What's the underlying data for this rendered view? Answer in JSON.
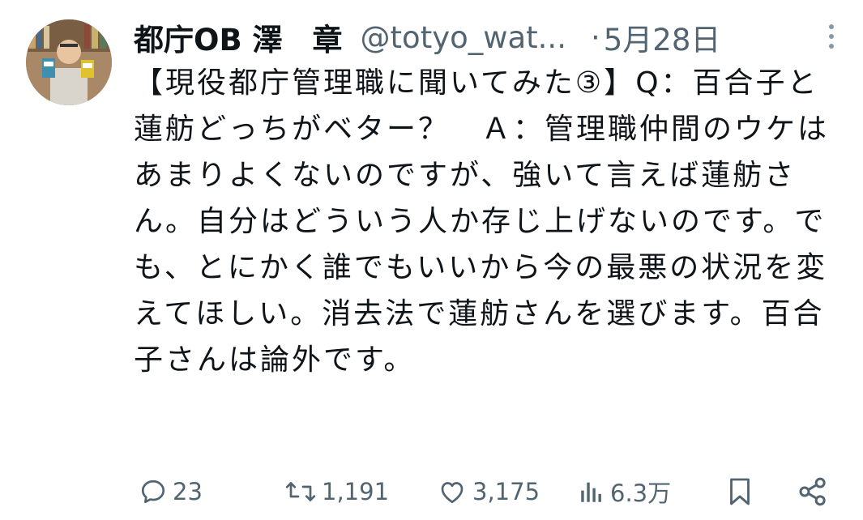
{
  "author": {
    "display_name": "都庁OB 澤　章",
    "handle": "@totyo_wat...",
    "separator": "·",
    "date": "5月28日"
  },
  "tweet": {
    "text": "【現役都庁管理職に聞いてみた③】Q：百合子と蓮舫どっちがベター？　Ａ：管理職仲間のウケはあまりよくないのですが、強いて言えば蓮舫さん。自分はどういう人か存じ上げないのです。でも、とにかく誰でもいいから今の最悪の状況を変えてほしい。消去法で蓮舫さんを選びます。百合子さんは論外です。"
  },
  "actions": {
    "reply": {
      "icon": "reply-icon",
      "count": "23"
    },
    "retweet": {
      "icon": "retweet-icon",
      "count": "1,191"
    },
    "like": {
      "icon": "heart-icon",
      "count": "3,175"
    },
    "views": {
      "icon": "views-icon",
      "count": "6.3万"
    },
    "bookmark": {
      "icon": "bookmark-icon"
    },
    "share": {
      "icon": "share-icon"
    }
  },
  "colors": {
    "text": "#0f1419",
    "secondary": "#536471",
    "background": "#ffffff"
  }
}
